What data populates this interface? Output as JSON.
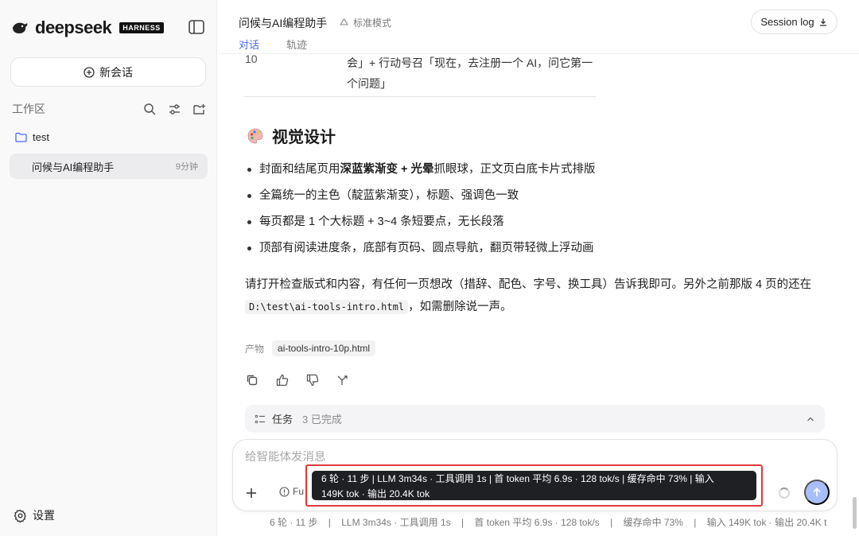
{
  "sidebar": {
    "brand": "deepseek",
    "brand_badge": "HARNESS",
    "new_chat_label": "新会话",
    "workspace_label": "工作区",
    "folder_name": "test",
    "session": {
      "title": "问候与AI编程助手",
      "time": "9分钟"
    },
    "settings_label": "设置"
  },
  "header": {
    "title": "问候与AI编程助手",
    "mode": "标准模式",
    "tabs": [
      {
        "label": "对话",
        "active": true
      },
      {
        "label": "轨迹",
        "active": false
      }
    ],
    "session_log_label": "Session log"
  },
  "message": {
    "table_tail": {
      "num": "10",
      "text": "会」+ 行动号召「现在，去注册一个 AI，问它第一个问题」"
    },
    "section_title": "视觉设计",
    "bullets": {
      "b1_pre": "封面和结尾页用",
      "b1_bold": "深蓝紫渐变 + 光晕",
      "b1_post": "抓眼球，正文页白底卡片式排版",
      "b2": "全篇统一的主色（靛蓝紫渐变），标题、强调色一致",
      "b3": "每页都是 1 个大标题 + 3~4 条短要点，无长段落",
      "b4": "顶部有阅读进度条，底部有页码、圆点导航，翻页带轻微上浮动画"
    },
    "para_pre": "请打开检查版式和内容，有任何一页想改（措辞、配色、字号、换工具）告诉我即可。另外之前那版 4 页的还在 ",
    "para_code": "D:\\test\\ai-tools-intro.html",
    "para_post": "，如需删除说一声。",
    "artifact_label": "产物",
    "artifact_file": "ai-tools-intro-10p.html"
  },
  "tasks": {
    "label": "任务",
    "count": "3 已完成"
  },
  "composer": {
    "placeholder": "给智能体发消息",
    "model_label": "Fu"
  },
  "tooltip": {
    "line1": "6 轮 · 11 步 | LLM 3m34s · 工具调用 1s | 首 token 平均 6.9s · 128 tok/s | 缓存命中 73% | 输入",
    "line2": "149K tok · 输出 20.4K tok"
  },
  "stats": "6 轮 · 11 步    |    LLM 3m34s · 工具调用 1s    |    首 token 平均 6.9s · 128 tok/s    |    缓存命中 73%    |    输入 149K tok · 输出 20.4K t",
  "colors": {
    "accent": "#4d6bfe",
    "send_disabled": "#a9bffd",
    "highlight_border": "#e0393e"
  }
}
